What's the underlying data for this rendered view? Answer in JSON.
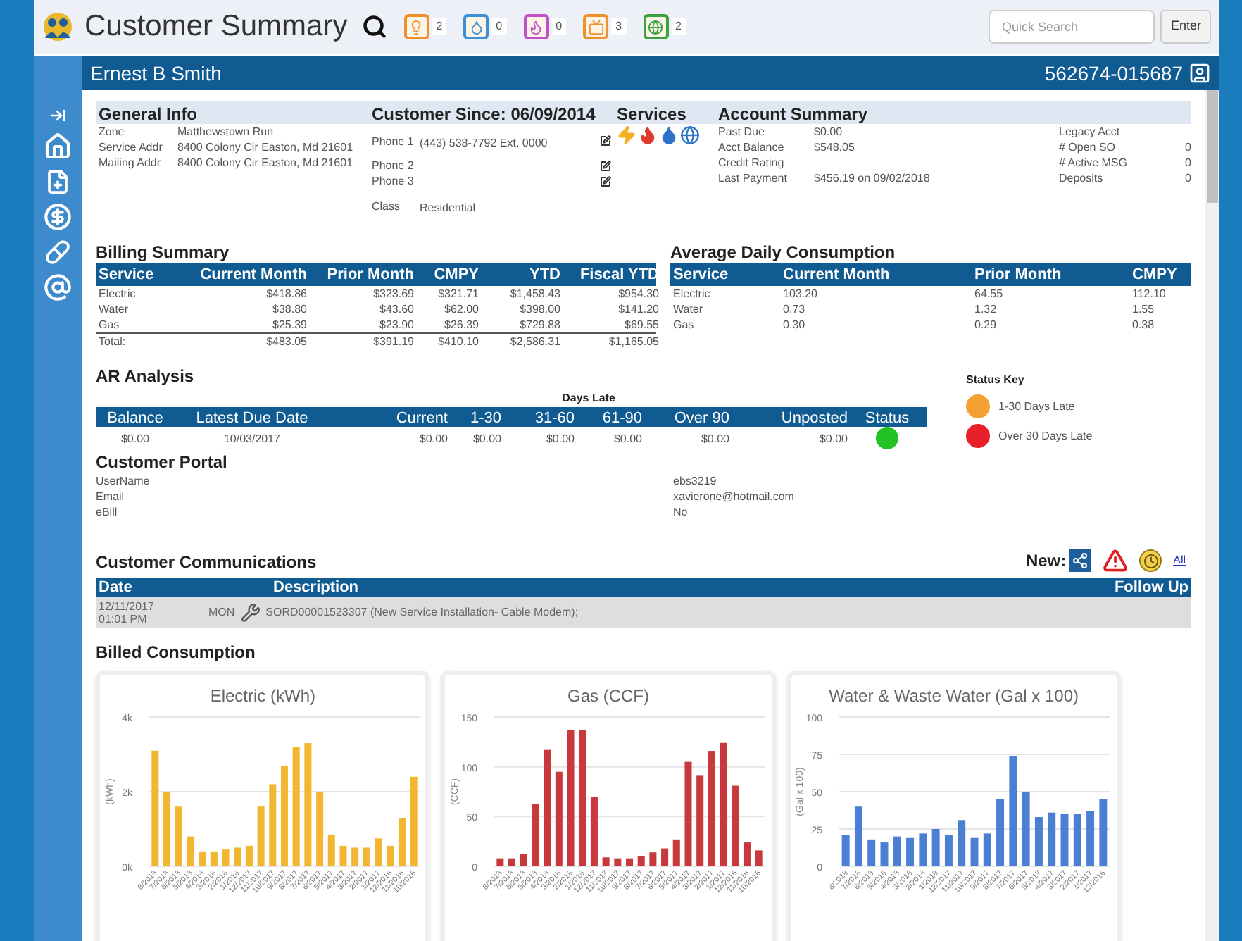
{
  "header": {
    "title": "Customer Summary",
    "badges": [
      {
        "kind": "bulb",
        "count": "2",
        "color": "#f0902c"
      },
      {
        "kind": "drop",
        "count": "0",
        "color": "#3a8fd6"
      },
      {
        "kind": "flame",
        "count": "0",
        "color": "#c04fc8"
      },
      {
        "kind": "tv",
        "count": "3",
        "color": "#f0902c"
      },
      {
        "kind": "globe",
        "count": "2",
        "color": "#3aa040"
      }
    ],
    "quick_search": {
      "placeholder": "Quick Search"
    },
    "enter_button": "Enter"
  },
  "customer": {
    "name": "Ernest B Smith",
    "account": "562674-015687"
  },
  "general_info": {
    "title": "General Info",
    "fields": [
      {
        "label": "Zone",
        "value": "Matthewstown Run"
      },
      {
        "label": "Service Addr",
        "value": "8400 Colony Cir Easton, Md 21601"
      },
      {
        "label": "Mailing Addr",
        "value": "8400 Colony Cir Easton, Md 21601"
      }
    ]
  },
  "customer_since": {
    "title": "Customer Since: 06/09/2014",
    "phones": [
      {
        "label": "Phone 1",
        "value": "(443) 538-7792 Ext. 0000",
        "editable": true
      },
      {
        "label": "Phone 2",
        "editable": true
      },
      {
        "label": "Phone 3",
        "editable": true
      },
      {
        "label": "Class",
        "value": "Residential",
        "editable": false
      }
    ]
  },
  "services": {
    "title": "Services"
  },
  "account_summary": {
    "title": "Account Summary",
    "left": [
      {
        "label": "Past Due",
        "value": "$0.00"
      },
      {
        "label": "Acct Balance",
        "value": "$548.05"
      },
      {
        "label": "Credit Rating"
      },
      {
        "label": "Last Payment",
        "value": "$456.19 on 09/02/2018"
      }
    ],
    "right": [
      {
        "label": "Legacy Acct"
      },
      {
        "label": "# Open SO",
        "value": "0"
      },
      {
        "label": "# Active MSG",
        "value": "0"
      },
      {
        "label": "Deposits",
        "value": "0"
      }
    ]
  },
  "billing_summary": {
    "title": "Billing Summary",
    "columns": [
      "Service",
      "Current Month",
      "Prior Month",
      "CMPY",
      "YTD",
      "Fiscal YTD"
    ],
    "rows": [
      [
        "Electric",
        "$418.86",
        "$323.69",
        "$321.71",
        "$1,458.43",
        "$954.30"
      ],
      [
        "Water",
        "$38.80",
        "$43.60",
        "$62.00",
        "$398.00",
        "$141.20"
      ],
      [
        "Gas",
        "$25.39",
        "$23.90",
        "$26.39",
        "$729.88",
        "$69.55"
      ]
    ],
    "total": [
      "Total:",
      "$483.05",
      "$391.19",
      "$410.10",
      "$2,586.31",
      "$1,165.05"
    ]
  },
  "average_daily_consumption": {
    "title": "Average Daily Consumption",
    "columns": [
      "Service",
      "Current Month",
      "Prior Month",
      "CMPY"
    ],
    "rows": [
      [
        "Electric",
        "103.20",
        "64.55",
        "112.10"
      ],
      [
        "Water",
        "0.73",
        "1.32",
        "1.55"
      ],
      [
        "Gas",
        "0.30",
        "0.29",
        "0.38"
      ]
    ]
  },
  "ar_analysis": {
    "title": "AR Analysis",
    "group_label": "Days Late",
    "columns": [
      "Balance",
      "Latest Due Date",
      "Current",
      "1-30",
      "31-60",
      "61-90",
      "Over 90",
      "Unposted",
      "Status"
    ],
    "row": {
      "cells": [
        "$0.00",
        "10/03/2017",
        "$0.00",
        "$0.00",
        "$0.00",
        "$0.00",
        "$0.00",
        "$0.00"
      ],
      "color": "#22c322"
    }
  },
  "status_key": {
    "title": "Status Key",
    "items": [
      {
        "label": "1-30 Days Late",
        "color": "#f5a032"
      },
      {
        "label": "Over 30 Days Late",
        "color": "#e8202a"
      }
    ]
  },
  "customer_portal": {
    "title": "Customer Portal",
    "fields": [
      {
        "label": "UserName",
        "value": "ebs3219"
      },
      {
        "label": "Email",
        "value": "xavierone@hotmail.com"
      },
      {
        "label": "eBill",
        "value": "No"
      }
    ]
  },
  "communications": {
    "title": "Customer Communications",
    "new_label": "New:",
    "new_items": [
      {
        "kind": "share"
      },
      {
        "kind": "alert"
      },
      {
        "kind": "clock"
      }
    ],
    "all_link": "All",
    "columns": [
      "Date",
      "Description",
      "Follow Up"
    ],
    "rows": [
      {
        "date": "12/11/2017 01:01 PM",
        "day": "MON",
        "kind": "service",
        "description": "SORD00001523307 (New Service Installation- Cable Modem);"
      }
    ]
  },
  "billed_consumption": {
    "title": "Billed Consumption",
    "charts": [
      {
        "chart_data": {
          "type": "bar",
          "title": "Electric (kWh)",
          "ylabel": "(kWh)",
          "ylim": [
            0,
            4000
          ],
          "grid": true,
          "yticks": [
            {
              "value": 0,
              "label": "0k"
            },
            {
              "value": 2000,
              "label": "2k"
            },
            {
              "value": 4000,
              "label": "4k"
            }
          ],
          "categories": [
            "8/2018",
            "7/2018",
            "6/2018",
            "5/2018",
            "4/2018",
            "3/2018",
            "2/2018",
            "1/2018",
            "12/2017",
            "11/2017",
            "10/2017",
            "9/2017",
            "8/2017",
            "7/2017",
            "6/2017",
            "5/2017",
            "4/2017",
            "3/2017",
            "2/2017",
            "1/2017",
            "12/2016",
            "11/2016",
            "10/2016"
          ],
          "series": [
            {
              "color": "#f2b630",
              "values": [
                3100,
                2000,
                1600,
                800,
                400,
                400,
                450,
                500,
                550,
                1600,
                2200,
                2700,
                3200,
                3300,
                2000,
                850,
                550,
                500,
                500,
                750,
                550,
                1300,
                2400
              ]
            }
          ]
        }
      },
      {
        "chart_data": {
          "type": "bar",
          "title": "Gas (CCF)",
          "ylabel": "(CCF)",
          "ylim": [
            0,
            150
          ],
          "grid": true,
          "yticks": [
            0,
            50,
            100,
            150
          ],
          "categories": [
            "8/2018",
            "7/2018",
            "6/2018",
            "5/2018",
            "4/2018",
            "3/2018",
            "2/2018",
            "1/2018",
            "12/2017",
            "11/2017",
            "10/2017",
            "9/2017",
            "8/2017",
            "7/2017",
            "6/2017",
            "5/2017",
            "4/2017",
            "3/2017",
            "2/2017",
            "1/2017",
            "12/2016",
            "11/2016",
            "10/2016"
          ],
          "series": [
            {
              "color": "#c8383c",
              "values": [
                8,
                8,
                12,
                63,
                117,
                95,
                137,
                137,
                70,
                9,
                8,
                8,
                10,
                14,
                18,
                27,
                105,
                91,
                116,
                124,
                81,
                24,
                16
              ]
            }
          ]
        }
      },
      {
        "chart_data": {
          "type": "bar",
          "title": "Water & Waste Water (Gal x 100)",
          "ylabel": "(Gal x 100)",
          "ylim": [
            0,
            100
          ],
          "grid": true,
          "yticks": [
            0,
            25,
            50,
            75,
            100
          ],
          "categories": [
            "8/2018",
            "7/2018",
            "6/2018",
            "5/2018",
            "4/2018",
            "3/2018",
            "2/2018",
            "1/2018",
            "12/2017",
            "11/2017",
            "10/2017",
            "9/2017",
            "8/2017",
            "7/2017",
            "6/2017",
            "5/2017",
            "4/2017",
            "3/2017",
            "2/2017",
            "1/2017",
            "12/2016"
          ],
          "series": [
            {
              "color": "#4a7fd4",
              "values": [
                21,
                40,
                18,
                16,
                20,
                19,
                22,
                25,
                21,
                31,
                19,
                22,
                45,
                74,
                50,
                33,
                36,
                35,
                35,
                37,
                45
              ]
            }
          ]
        }
      }
    ]
  }
}
